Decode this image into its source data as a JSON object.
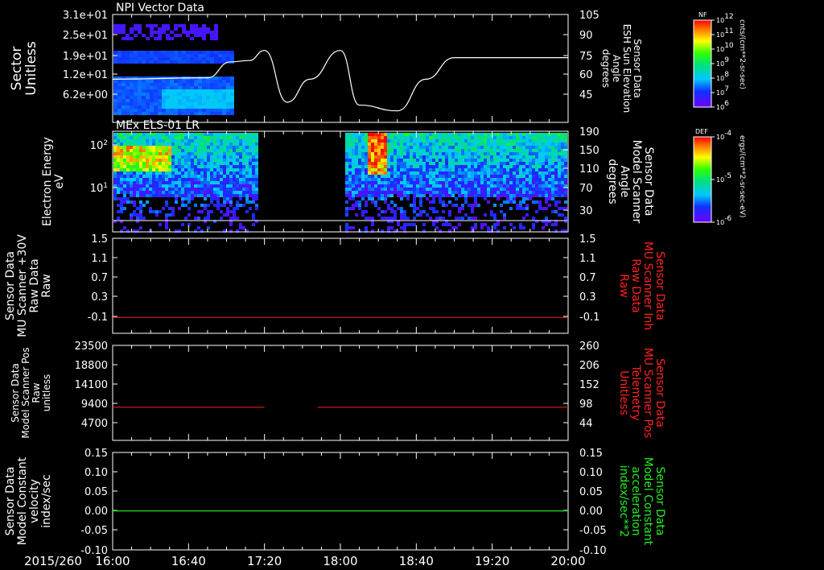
{
  "date_label": "2015/260",
  "time_ticks": [
    "16:00",
    "16:40",
    "17:20",
    "18:00",
    "18:40",
    "19:20",
    "20:00"
  ],
  "chart_data": [
    {
      "type": "heatmap",
      "title": "NPI Vector Data",
      "ylabel": [
        "Sector",
        "Unitless"
      ],
      "y_ticks": [
        "3.1e+01",
        "2.5e+01",
        "1.9e+01",
        "1.2e+01",
        "6.2e+00"
      ],
      "right_ylabel": [
        "Sensor Data",
        "ESH Sun Elevation",
        "Angle",
        "degrees"
      ],
      "right_ticks": [
        "105",
        "90",
        "75",
        "60",
        "45"
      ],
      "colorbar": {
        "label": "NF",
        "units": "cnts/(cm**2-sr-sec)",
        "ticks": [
          "10^12",
          "10^11",
          "10^10",
          "10^9",
          "10^8",
          "10^7",
          "10^6"
        ]
      },
      "line_series": {
        "name": "ESH Sun Elevation Angle",
        "x": [
          "16:00",
          "16:50",
          "17:02",
          "17:12",
          "17:20",
          "17:32",
          "17:44",
          "18:00",
          "18:10",
          "18:30",
          "18:45",
          "19:00",
          "20:00"
        ],
        "y": [
          60,
          61,
          72,
          73,
          80,
          44,
          60,
          80,
          42,
          38,
          60,
          75,
          75
        ]
      }
    },
    {
      "type": "heatmap",
      "title": "MEx ELS-01 LR",
      "ylabel": [
        "Electron Energy",
        "eV"
      ],
      "y_ticks": [
        "10^2",
        "10^1"
      ],
      "right_ylabel": [
        "Sensor Data",
        "Model Scanner",
        "Angle",
        "degrees"
      ],
      "right_ticks": [
        "190",
        "150",
        "110",
        "70",
        "30"
      ],
      "colorbar": {
        "label": "DEF",
        "units": "ergs/(cm**2-sr-sec-eV)",
        "ticks": [
          "10^-4",
          "10^-5",
          "10^-6"
        ]
      },
      "gap": [
        "17:16",
        "18:01"
      ],
      "line_series": {
        "name": "Model Scanner Angle",
        "value": 10
      }
    },
    {
      "type": "line",
      "ylabel": [
        "Sensor Data",
        "MU Scanner +30V",
        "Raw Data",
        "Raw"
      ],
      "y_ticks": [
        "1.5",
        "1.1",
        "0.7",
        "0.3",
        "-0.1"
      ],
      "right_ylabel": [
        "Sensor Data",
        "MU Scanner Inh",
        "Raw Data",
        "Raw"
      ],
      "right_ticks": [
        "1.5",
        "1.1",
        "0.7",
        "0.3",
        "-0.1"
      ],
      "ylim": [
        -0.3,
        1.5
      ],
      "series": [
        {
          "name": "MU Scanner Inh",
          "color": "#dd2020",
          "x": [
            "16:00",
            "20:00"
          ],
          "y": [
            0,
            0
          ]
        }
      ]
    },
    {
      "type": "line",
      "ylabel": [
        "Sensor Data",
        "Model Scanner Pos",
        "Raw",
        "unitless"
      ],
      "y_ticks": [
        "23500",
        "18800",
        "14100",
        "9400",
        "4700"
      ],
      "right_ylabel": [
        "Sensor Data",
        "MU Scanner Pos",
        "Telemetry",
        "Unitless"
      ],
      "right_ticks": [
        "260",
        "206",
        "152",
        "98",
        "44"
      ],
      "ylim": [
        0,
        23500
      ],
      "series": [
        {
          "name": "MU Scanner Pos",
          "color": "#dd2020",
          "x": [
            "16:00",
            "17:20"
          ],
          "y": [
            8200,
            8200
          ]
        },
        {
          "name": "MU Scanner Pos",
          "color": "#dd2020",
          "x": [
            "17:48",
            "20:00"
          ],
          "y": [
            8200,
            8200
          ]
        }
      ]
    },
    {
      "type": "line",
      "ylabel": [
        "Sensor Data",
        "Model Constant",
        "velocity",
        "index/sec"
      ],
      "y_ticks": [
        "0.15",
        "0.10",
        "0.05",
        "0.00",
        "-0.05",
        "-0.10"
      ],
      "right_ylabel": [
        "Sensor Data",
        "Model Constant",
        "acceleration",
        "index/sec**2"
      ],
      "right_ticks": [
        "0.15",
        "0.10",
        "0.05",
        "0.00",
        "-0.05",
        "-0.10"
      ],
      "ylim": [
        -0.1,
        0.15
      ],
      "series": [
        {
          "name": "Model Constant acceleration",
          "color": "#22dd22",
          "x": [
            "16:00",
            "20:00"
          ],
          "y": [
            0,
            0
          ]
        }
      ]
    }
  ]
}
